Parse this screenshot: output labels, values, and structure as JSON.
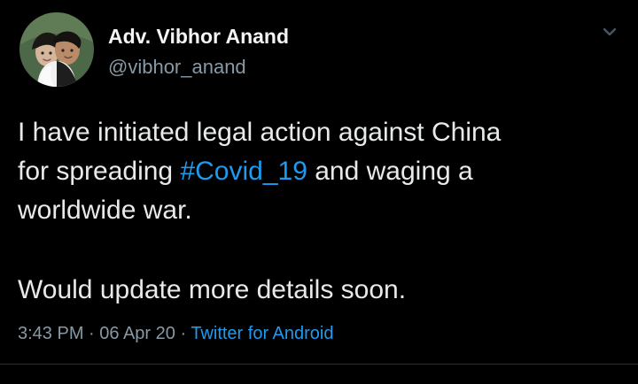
{
  "user": {
    "display_name": "Adv. Vibhor Anand",
    "handle": "@vibhor_anand"
  },
  "tweet": {
    "line1_a": "I have initiated legal action against China",
    "line2_a": "for spreading ",
    "hashtag": "#Covid_19",
    "line2_b": " and waging a",
    "line3": "worldwide war.",
    "line4": "Would update more details soon."
  },
  "meta": {
    "time": "3:43 PM",
    "sep1": " · ",
    "date": "06 Apr 20",
    "sep2": " · ",
    "source": "Twitter for Android"
  },
  "icons": {
    "avatar": "profile-photo",
    "menu": "chevron-down-icon"
  },
  "colors": {
    "background": "#000000",
    "text": "#e7e9ea",
    "secondary": "#8899a6",
    "accent": "#1d9bf0"
  }
}
